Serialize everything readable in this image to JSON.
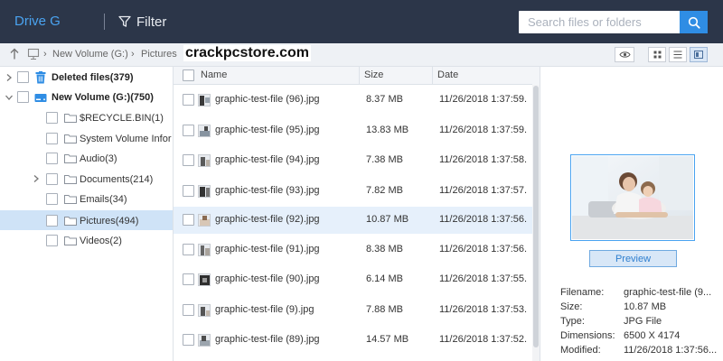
{
  "app": {
    "drive_title": "Drive G"
  },
  "toolbar": {
    "filter_label": "Filter",
    "search_placeholder": "Search files or folders"
  },
  "breadcrumb": {
    "items": [
      "New Volume (G:)",
      "Pictures"
    ],
    "watermark": "crackpcstore.com"
  },
  "tree": [
    {
      "label": "Deleted files(379)",
      "bold": true,
      "icon": "trash-icon",
      "expandable": true,
      "level": 0,
      "selected": false
    },
    {
      "label": "New Volume (G:)(750)",
      "bold": true,
      "icon": "drive-icon",
      "expandable": true,
      "expanded": true,
      "level": 0,
      "selected": false
    },
    {
      "label": "$RECYCLE.BIN(1)",
      "bold": false,
      "icon": "folder-icon",
      "level": 1,
      "selected": false
    },
    {
      "label": "System Volume Informati",
      "bold": false,
      "icon": "folder-icon",
      "level": 1,
      "selected": false
    },
    {
      "label": "Audio(3)",
      "bold": false,
      "icon": "folder-icon",
      "level": 1,
      "selected": false
    },
    {
      "label": "Documents(214)",
      "bold": false,
      "icon": "folder-icon",
      "expandable": true,
      "level": 1,
      "selected": false
    },
    {
      "label": "Emails(34)",
      "bold": false,
      "icon": "folder-icon",
      "level": 1,
      "selected": false
    },
    {
      "label": "Pictures(494)",
      "bold": false,
      "icon": "folder-icon",
      "level": 1,
      "selected": true
    },
    {
      "label": "Videos(2)",
      "bold": false,
      "icon": "folder-icon",
      "level": 1,
      "selected": false
    }
  ],
  "columns": {
    "name": "Name",
    "size": "Size",
    "date": "Date"
  },
  "files": [
    {
      "name": "graphic-test-file (96).jpg",
      "size": "8.37 MB",
      "date": "11/26/2018 1:37:59.",
      "selected": false
    },
    {
      "name": "graphic-test-file (95).jpg",
      "size": "13.83 MB",
      "date": "11/26/2018 1:37:59.",
      "selected": false
    },
    {
      "name": "graphic-test-file (94).jpg",
      "size": "7.38 MB",
      "date": "11/26/2018 1:37:58.",
      "selected": false
    },
    {
      "name": "graphic-test-file (93).jpg",
      "size": "7.82 MB",
      "date": "11/26/2018 1:37:57.",
      "selected": false
    },
    {
      "name": "graphic-test-file (92).jpg",
      "size": "10.87 MB",
      "date": "11/26/2018 1:37:56.",
      "selected": true
    },
    {
      "name": "graphic-test-file (91).jpg",
      "size": "8.38 MB",
      "date": "11/26/2018 1:37:56.",
      "selected": false
    },
    {
      "name": "graphic-test-file (90).jpg",
      "size": "6.14 MB",
      "date": "11/26/2018 1:37:55.",
      "selected": false
    },
    {
      "name": "graphic-test-file (9).jpg",
      "size": "7.88 MB",
      "date": "11/26/2018 1:37:53.",
      "selected": false
    },
    {
      "name": "graphic-test-file (89).jpg",
      "size": "14.57 MB",
      "date": "11/26/2018 1:37:52.",
      "selected": false
    }
  ],
  "preview": {
    "button_label": "Preview",
    "meta": [
      {
        "key": "Filename:",
        "value": "graphic-test-file (9..."
      },
      {
        "key": "Size:",
        "value": "10.87 MB"
      },
      {
        "key": "Type:",
        "value": "JPG File"
      },
      {
        "key": "Dimensions:",
        "value": "6500 X 4174"
      },
      {
        "key": "Modified:",
        "value": "11/26/2018 1:37:56..."
      }
    ]
  },
  "colors": {
    "topbar": "#2c3649",
    "accent": "#2f8de4",
    "title_blue": "#4aa3f0",
    "selected_row": "#cfe3f7"
  }
}
